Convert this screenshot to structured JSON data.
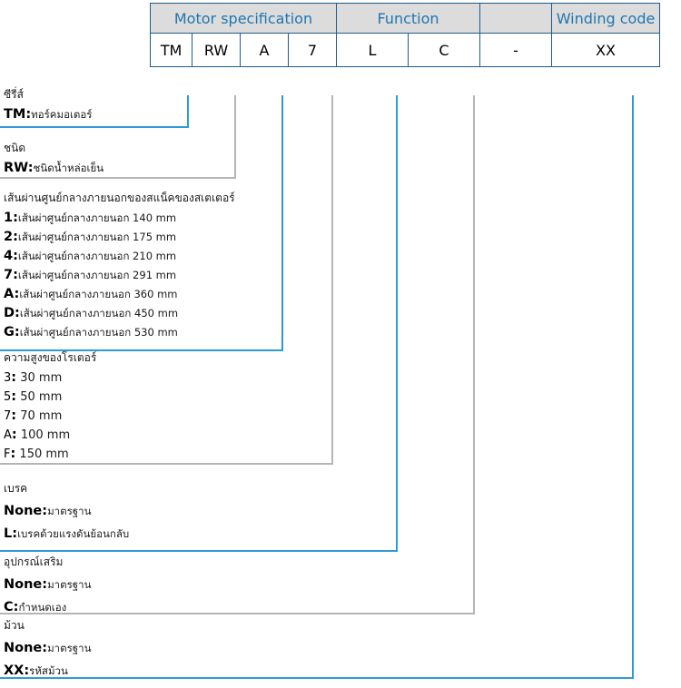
{
  "table": {
    "groups": [
      {
        "label": "Motor specification",
        "span": 4
      },
      {
        "label": "Function",
        "span": 2
      },
      {
        "label": "",
        "span": 1
      },
      {
        "label": "Winding code",
        "span": 1
      }
    ],
    "codes": [
      "TM",
      "RW",
      "A",
      "7",
      "L",
      "C",
      "-",
      "XX"
    ]
  },
  "colors": {
    "header_bg": "#dcdcdc",
    "header_text": "#2176ae",
    "border": "#1f5c8b",
    "leader_blue": "#2e9bd6",
    "leader_gray": "#b5b5b5"
  },
  "sections": [
    {
      "title": "ซีรี่ส์",
      "lines": [
        {
          "key": "TM",
          "sep": ":",
          "text": "ทอร์คมอเตอร์"
        }
      ]
    },
    {
      "title": "ชนิด",
      "lines": [
        {
          "key": "RW",
          "sep": ":",
          "text": "ชนิดน้ำหล่อเย็น"
        }
      ]
    },
    {
      "title": "เส้นผ่านศูนย์กลางภายนอกของสแน็คของสเตเตอร์",
      "lines": [
        {
          "key": "1",
          "sep": ":",
          "text": "เส้นผ่าศูนย์กลางภายนอก 140 mm"
        },
        {
          "key": "2",
          "sep": ":",
          "text": "เส้นผ่าศูนย์กลางภายนอก 175 mm"
        },
        {
          "key": "4",
          "sep": ":",
          "text": "เส้นผ่าศูนย์กลางภายนอก 210 mm"
        },
        {
          "key": "7",
          "sep": ":",
          "text": "เส้นผ่าศูนย์กลางภายนอก 291 mm"
        },
        {
          "key": "A",
          "sep": ":",
          "text": "เส้นผ่าศูนย์กลางภายนอก 360 mm"
        },
        {
          "key": "D",
          "sep": ":",
          "text": "เส้นผ่าศูนย์กลางภายนอก 450 mm"
        },
        {
          "key": "G",
          "sep": ":",
          "text": "เส้นผ่าศูนย์กลางภายนอก 530 mm"
        }
      ]
    },
    {
      "title": "ความสูงของโรเตอร์",
      "lines": [
        {
          "key": "3",
          "sep": ":",
          "text": " 30 mm"
        },
        {
          "key": "5",
          "sep": ":",
          "text": " 50 mm"
        },
        {
          "key": "7",
          "sep": ":",
          "text": " 70 mm"
        },
        {
          "key": "A",
          "sep": ":",
          "text": " 100 mm"
        },
        {
          "key": "F",
          "sep": ":",
          "text": " 150 mm"
        }
      ]
    },
    {
      "title": "เบรค",
      "lines": [
        {
          "key": "None",
          "sep": ":",
          "text": "มาตรฐาน"
        },
        {
          "key": "L",
          "sep": ":",
          "text": "เบรคด้วยแรงดันย้อนกลับ"
        }
      ]
    },
    {
      "title": "อุปกรณ์เสริม",
      "lines": [
        {
          "key": "None",
          "sep": ":",
          "text": "มาตรฐาน"
        },
        {
          "key": "C",
          "sep": ":",
          "text": "กำหนดเอง"
        }
      ]
    },
    {
      "title": "ม้วน",
      "lines": [
        {
          "key": "None",
          "sep": ":",
          "text": "มาตรฐาน"
        },
        {
          "key": "XX",
          "sep": ":",
          "text": "รหัสม้วน"
        }
      ]
    }
  ]
}
